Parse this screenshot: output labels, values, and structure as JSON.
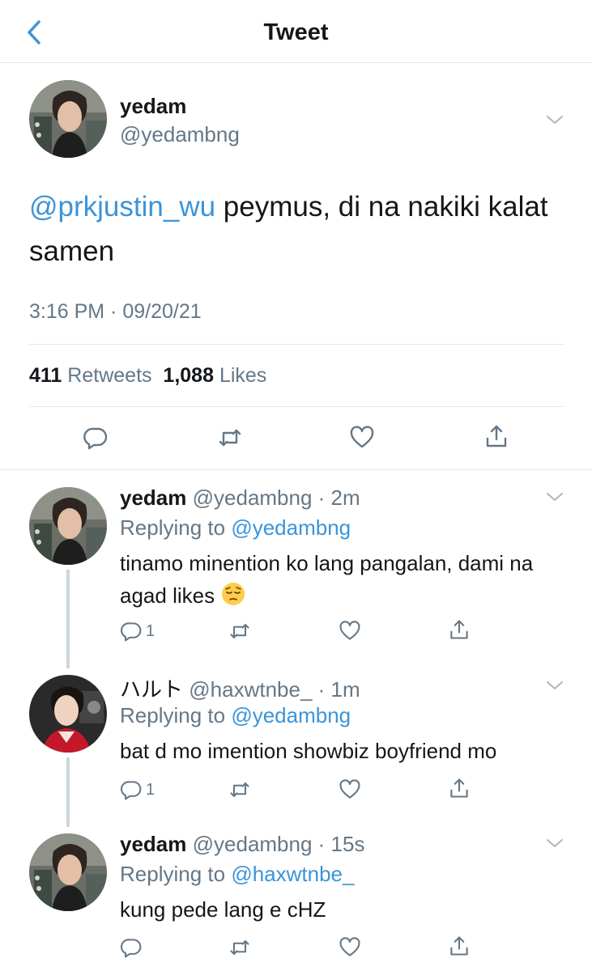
{
  "header": {
    "title": "Tweet",
    "back_icon": "chevron-left-icon"
  },
  "main_tweet": {
    "name": "yedam",
    "handle": "@yedambng",
    "mention": "@prkjustin_wu",
    "text": " peymus, di na nakiki kalat samen",
    "timestamp": "3:16 PM · 09/20/21",
    "retweets_count": "411",
    "retweets_label": "Retweets",
    "likes_count": "1,088",
    "likes_label": "Likes"
  },
  "replies": [
    {
      "name": "yedam",
      "handle": "@yedambng",
      "time": "2m",
      "replying_label": "Replying to",
      "replying_to": "@yedambng",
      "text": "tinamo minention ko lang pangalan, dami na agad likes",
      "emoji": "pensive-face",
      "reply_count": "1"
    },
    {
      "name": "ハルト",
      "handle": "@haxwtnbe_",
      "time": "1m",
      "replying_label": "Replying to",
      "replying_to": "@yedambng",
      "text": "bat d mo imention showbiz boyfriend mo",
      "reply_count": "1"
    },
    {
      "name": "yedam",
      "handle": "@yedambng",
      "time": "15s",
      "replying_label": "Replying to",
      "replying_to": "@haxwtnbe_",
      "text": "kung pede lang e cHZ",
      "reply_count": ""
    }
  ],
  "colors": {
    "accent": "#3b94d9",
    "secondary_text": "#657786",
    "divider": "#e1e8ed"
  }
}
